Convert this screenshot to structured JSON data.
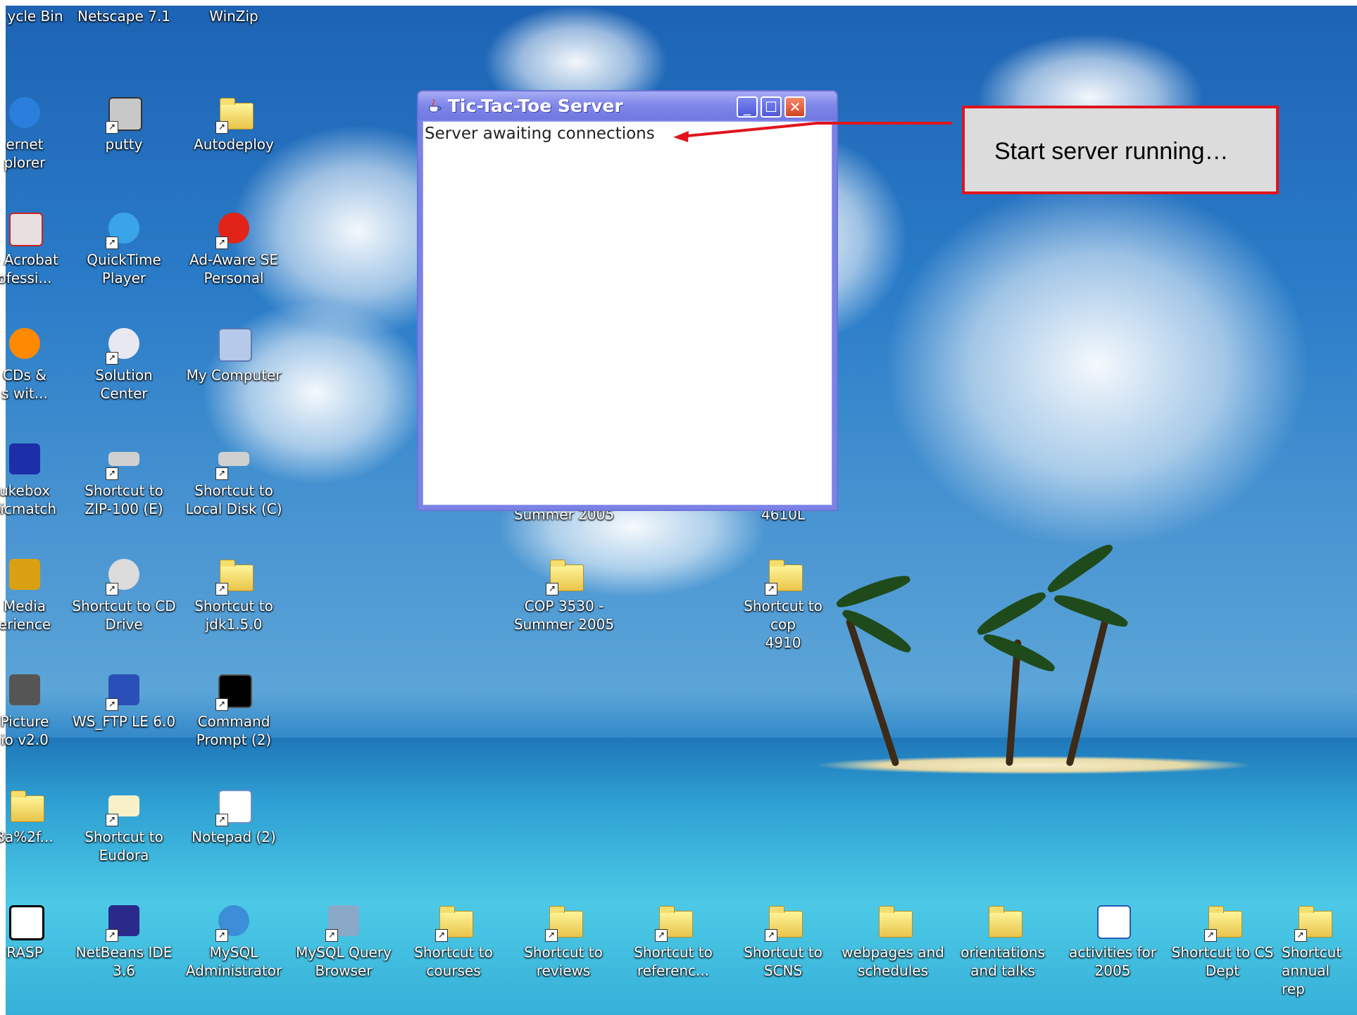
{
  "window": {
    "title": "Tic-Tac-Toe Server",
    "status_text": "Server awaiting connections",
    "min_glyph": "_",
    "max_glyph": "☐",
    "close_glyph": "✕"
  },
  "annotation": {
    "text": "Start server running…",
    "border_color": "#e1141c"
  },
  "desktop_icons": {
    "col0": [
      "ycle Bin",
      "ernet\nplorer",
      "e Acrobat\nofessi...",
      "CDs &\ns wit...",
      "ukebox\nsicmatch",
      "Media\nerience",
      "Picture\nio v2.0",
      "3a%2f...",
      "RASP"
    ],
    "col1": [
      "Netscape 7.1",
      "putty",
      "QuickTime\nPlayer",
      "Solution Center",
      "Shortcut to\nZIP-100 (E)",
      "Shortcut to CD\nDrive",
      "WS_FTP LE 6.0",
      "Shortcut to\nEudora",
      "NetBeans IDE\n3.6"
    ],
    "col2": [
      "WinZip",
      "Autodeploy",
      "Ad-Aware SE\nPersonal",
      "My Computer",
      "Shortcut to\nLocal Disk (C)",
      "Shortcut to\njdk1.5.0",
      "Command\nPrompt (2)",
      "Notepad (2)",
      "MySQL\nAdministrator"
    ],
    "middle": [
      "Summer 2005",
      "4610L",
      "COP 3530 -\nSummer 2005",
      "Shortcut to cop\n4910"
    ],
    "bottom_row": [
      "MySQL Query\nBrowser",
      "Shortcut to\ncourses",
      "Shortcut to\nreviews",
      "Shortcut to\nreferenc...",
      "Shortcut to\nSCNS",
      "webpages and\nschedules",
      "orientations\nand talks",
      "activities for\n2005",
      "Shortcut to CS\nDept",
      "Shortcut\nannual rep"
    ]
  }
}
